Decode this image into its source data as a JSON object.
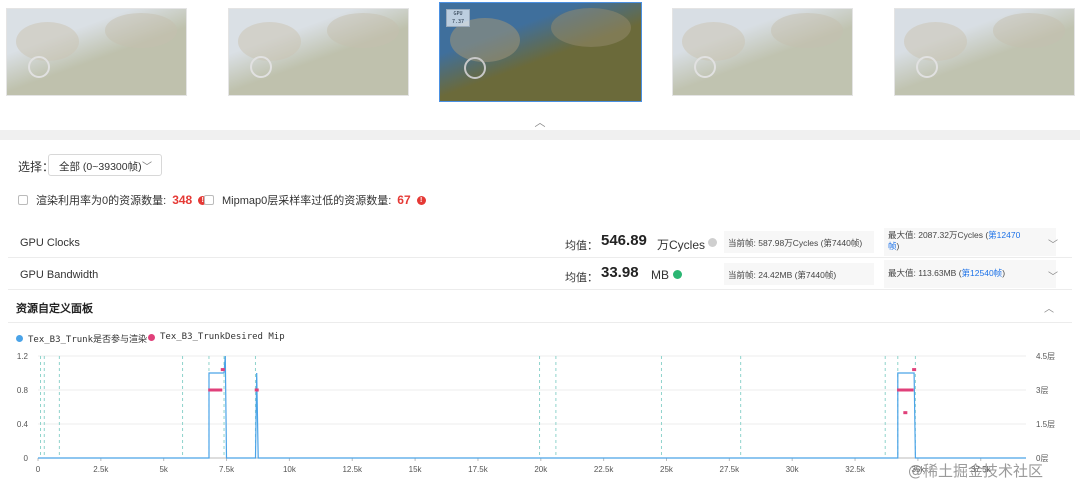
{
  "thumbnails": [
    {
      "active": false,
      "sky": "#bcc6cf",
      "ground": "#8a8f6a"
    },
    {
      "active": false,
      "sky": "#bcc6cf",
      "ground": "#8a8f6a"
    },
    {
      "active": true,
      "sky": "#3f6f9c",
      "ground": "#6b6a3a",
      "ui_label_1": "GPU",
      "ui_label_2": "7.37"
    },
    {
      "active": false,
      "sky": "#b9c4ce",
      "ground": "#8d9270"
    },
    {
      "active": false,
      "sky": "#b9c4ce",
      "ground": "#8d9270"
    }
  ],
  "selector": {
    "label": "选择：",
    "value": "全部 (0~39300帧)"
  },
  "filters": [
    {
      "label": "渲染利用率为0的资源数量:",
      "count": "348"
    },
    {
      "label": "Mipmap0层采样率过低的资源数量:",
      "count": "67"
    }
  ],
  "metrics": [
    {
      "name": "GPU Clocks",
      "avg_label": "均值：",
      "avg_value": "546.89",
      "avg_unit": "万Cycles",
      "status": "info",
      "status_color": "#cfcfcf",
      "current": "当前帧:  587.98万Cycles (第7440帧)",
      "max_prefix": "最大值:  2087.32万Cycles (",
      "max_link": "第12470",
      "max_link2": "帧",
      "max_suffix": ")"
    },
    {
      "name": "GPU Bandwidth",
      "avg_label": "均值：",
      "avg_value": "33.98",
      "avg_unit": "MB",
      "status": "ok",
      "status_color": "#2bb673",
      "current": "当前帧:  24.42MB (第7440帧)",
      "max_prefix": "最大值:  113.63MB (",
      "max_link": "第12540帧",
      "max_link2": "",
      "max_suffix": ")"
    }
  ],
  "panel": {
    "title": "资源自定义面板"
  },
  "watermark": "@稀土掘金技术社区",
  "chart_data": {
    "type": "line",
    "series": [
      {
        "name": "Tex_B3_Trunk是否参与渲染",
        "color": "#4aa3e8",
        "axis": "left",
        "points": [
          [
            0,
            0
          ],
          [
            6800,
            0
          ],
          [
            6800,
            1
          ],
          [
            7400,
            1
          ],
          [
            7450,
            1.2
          ],
          [
            7500,
            0
          ],
          [
            8650,
            0
          ],
          [
            8700,
            1
          ],
          [
            8760,
            0
          ],
          [
            34200,
            0
          ],
          [
            34200,
            1
          ],
          [
            34850,
            1
          ],
          [
            34900,
            0
          ],
          [
            39300,
            0
          ]
        ]
      },
      {
        "name": "Tex_B3_TrunkDesired Mip",
        "color": "#e0407a",
        "axis": "right",
        "points": [
          [
            6850,
            3
          ],
          [
            6950,
            3
          ],
          [
            7050,
            3
          ],
          [
            7150,
            3
          ],
          [
            7250,
            3
          ],
          [
            7350,
            3.9
          ],
          [
            8700,
            3
          ],
          [
            34250,
            3
          ],
          [
            34350,
            3
          ],
          [
            34450,
            3
          ],
          [
            34500,
            2
          ],
          [
            34550,
            3
          ],
          [
            34650,
            3
          ],
          [
            34750,
            3
          ],
          [
            34850,
            3.9
          ]
        ]
      }
    ],
    "x_ticks": [
      "0",
      "2.5k",
      "5k",
      "7.5k",
      "10k",
      "12.5k",
      "15k",
      "17.5k",
      "20k",
      "22.5k",
      "25k",
      "27.5k",
      "30k",
      "32.5k",
      "35k",
      "37.5k"
    ],
    "x_tick_values": [
      0,
      2500,
      5000,
      7500,
      10000,
      12500,
      15000,
      17500,
      20000,
      22500,
      25000,
      27500,
      30000,
      32500,
      35000,
      37500
    ],
    "y_left_ticks": [
      "1.2",
      "0.8",
      "0.4",
      "0"
    ],
    "y_left_values": [
      1.2,
      0.8,
      0.4,
      0
    ],
    "y_right_ticks": [
      "4.5层",
      "3层",
      "1.5层",
      "0层"
    ],
    "y_right_values": [
      4.5,
      3,
      1.5,
      0
    ],
    "xlim": [
      0,
      39300
    ],
    "ylim_left": [
      0,
      1.2
    ],
    "ylim_right": [
      0,
      4.5
    ],
    "markers_x": [
      100,
      250,
      850,
      5750,
      6800,
      7400,
      8650,
      19950,
      20600,
      24800,
      27950,
      33700,
      34200,
      34900
    ]
  }
}
